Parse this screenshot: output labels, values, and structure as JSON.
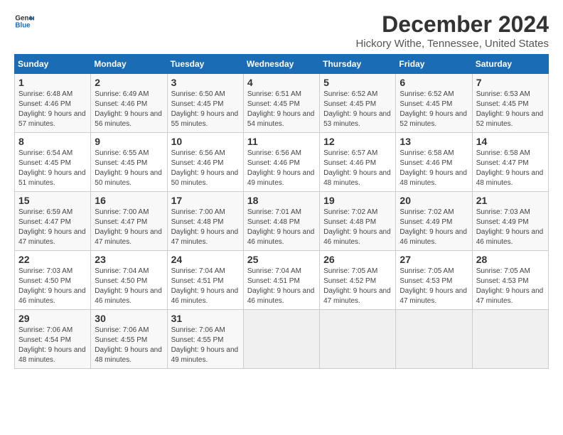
{
  "logo": {
    "line1": "General",
    "line2": "Blue"
  },
  "title": "December 2024",
  "subtitle": "Hickory Withe, Tennessee, United States",
  "headers": [
    "Sunday",
    "Monday",
    "Tuesday",
    "Wednesday",
    "Thursday",
    "Friday",
    "Saturday"
  ],
  "weeks": [
    [
      {
        "day": "1",
        "sunrise": "Sunrise: 6:48 AM",
        "sunset": "Sunset: 4:46 PM",
        "daylight": "Daylight: 9 hours and 57 minutes."
      },
      {
        "day": "2",
        "sunrise": "Sunrise: 6:49 AM",
        "sunset": "Sunset: 4:46 PM",
        "daylight": "Daylight: 9 hours and 56 minutes."
      },
      {
        "day": "3",
        "sunrise": "Sunrise: 6:50 AM",
        "sunset": "Sunset: 4:45 PM",
        "daylight": "Daylight: 9 hours and 55 minutes."
      },
      {
        "day": "4",
        "sunrise": "Sunrise: 6:51 AM",
        "sunset": "Sunset: 4:45 PM",
        "daylight": "Daylight: 9 hours and 54 minutes."
      },
      {
        "day": "5",
        "sunrise": "Sunrise: 6:52 AM",
        "sunset": "Sunset: 4:45 PM",
        "daylight": "Daylight: 9 hours and 53 minutes."
      },
      {
        "day": "6",
        "sunrise": "Sunrise: 6:52 AM",
        "sunset": "Sunset: 4:45 PM",
        "daylight": "Daylight: 9 hours and 52 minutes."
      },
      {
        "day": "7",
        "sunrise": "Sunrise: 6:53 AM",
        "sunset": "Sunset: 4:45 PM",
        "daylight": "Daylight: 9 hours and 52 minutes."
      }
    ],
    [
      {
        "day": "8",
        "sunrise": "Sunrise: 6:54 AM",
        "sunset": "Sunset: 4:45 PM",
        "daylight": "Daylight: 9 hours and 51 minutes."
      },
      {
        "day": "9",
        "sunrise": "Sunrise: 6:55 AM",
        "sunset": "Sunset: 4:45 PM",
        "daylight": "Daylight: 9 hours and 50 minutes."
      },
      {
        "day": "10",
        "sunrise": "Sunrise: 6:56 AM",
        "sunset": "Sunset: 4:46 PM",
        "daylight": "Daylight: 9 hours and 50 minutes."
      },
      {
        "day": "11",
        "sunrise": "Sunrise: 6:56 AM",
        "sunset": "Sunset: 4:46 PM",
        "daylight": "Daylight: 9 hours and 49 minutes."
      },
      {
        "day": "12",
        "sunrise": "Sunrise: 6:57 AM",
        "sunset": "Sunset: 4:46 PM",
        "daylight": "Daylight: 9 hours and 48 minutes."
      },
      {
        "day": "13",
        "sunrise": "Sunrise: 6:58 AM",
        "sunset": "Sunset: 4:46 PM",
        "daylight": "Daylight: 9 hours and 48 minutes."
      },
      {
        "day": "14",
        "sunrise": "Sunrise: 6:58 AM",
        "sunset": "Sunset: 4:47 PM",
        "daylight": "Daylight: 9 hours and 48 minutes."
      }
    ],
    [
      {
        "day": "15",
        "sunrise": "Sunrise: 6:59 AM",
        "sunset": "Sunset: 4:47 PM",
        "daylight": "Daylight: 9 hours and 47 minutes."
      },
      {
        "day": "16",
        "sunrise": "Sunrise: 7:00 AM",
        "sunset": "Sunset: 4:47 PM",
        "daylight": "Daylight: 9 hours and 47 minutes."
      },
      {
        "day": "17",
        "sunrise": "Sunrise: 7:00 AM",
        "sunset": "Sunset: 4:48 PM",
        "daylight": "Daylight: 9 hours and 47 minutes."
      },
      {
        "day": "18",
        "sunrise": "Sunrise: 7:01 AM",
        "sunset": "Sunset: 4:48 PM",
        "daylight": "Daylight: 9 hours and 46 minutes."
      },
      {
        "day": "19",
        "sunrise": "Sunrise: 7:02 AM",
        "sunset": "Sunset: 4:48 PM",
        "daylight": "Daylight: 9 hours and 46 minutes."
      },
      {
        "day": "20",
        "sunrise": "Sunrise: 7:02 AM",
        "sunset": "Sunset: 4:49 PM",
        "daylight": "Daylight: 9 hours and 46 minutes."
      },
      {
        "day": "21",
        "sunrise": "Sunrise: 7:03 AM",
        "sunset": "Sunset: 4:49 PM",
        "daylight": "Daylight: 9 hours and 46 minutes."
      }
    ],
    [
      {
        "day": "22",
        "sunrise": "Sunrise: 7:03 AM",
        "sunset": "Sunset: 4:50 PM",
        "daylight": "Daylight: 9 hours and 46 minutes."
      },
      {
        "day": "23",
        "sunrise": "Sunrise: 7:04 AM",
        "sunset": "Sunset: 4:50 PM",
        "daylight": "Daylight: 9 hours and 46 minutes."
      },
      {
        "day": "24",
        "sunrise": "Sunrise: 7:04 AM",
        "sunset": "Sunset: 4:51 PM",
        "daylight": "Daylight: 9 hours and 46 minutes."
      },
      {
        "day": "25",
        "sunrise": "Sunrise: 7:04 AM",
        "sunset": "Sunset: 4:51 PM",
        "daylight": "Daylight: 9 hours and 46 minutes."
      },
      {
        "day": "26",
        "sunrise": "Sunrise: 7:05 AM",
        "sunset": "Sunset: 4:52 PM",
        "daylight": "Daylight: 9 hours and 47 minutes."
      },
      {
        "day": "27",
        "sunrise": "Sunrise: 7:05 AM",
        "sunset": "Sunset: 4:53 PM",
        "daylight": "Daylight: 9 hours and 47 minutes."
      },
      {
        "day": "28",
        "sunrise": "Sunrise: 7:05 AM",
        "sunset": "Sunset: 4:53 PM",
        "daylight": "Daylight: 9 hours and 47 minutes."
      }
    ],
    [
      {
        "day": "29",
        "sunrise": "Sunrise: 7:06 AM",
        "sunset": "Sunset: 4:54 PM",
        "daylight": "Daylight: 9 hours and 48 minutes."
      },
      {
        "day": "30",
        "sunrise": "Sunrise: 7:06 AM",
        "sunset": "Sunset: 4:55 PM",
        "daylight": "Daylight: 9 hours and 48 minutes."
      },
      {
        "day": "31",
        "sunrise": "Sunrise: 7:06 AM",
        "sunset": "Sunset: 4:55 PM",
        "daylight": "Daylight: 9 hours and 49 minutes."
      },
      null,
      null,
      null,
      null
    ]
  ]
}
